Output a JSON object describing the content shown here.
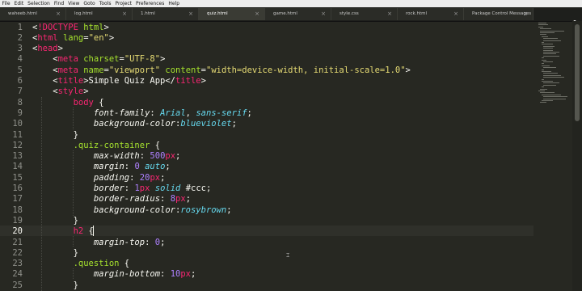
{
  "menu": [
    "File",
    "Edit",
    "Selection",
    "Find",
    "View",
    "Goto",
    "Tools",
    "Project",
    "Preferences",
    "Help"
  ],
  "tabs": [
    {
      "label": "waheeb.html",
      "active": false
    },
    {
      "label": "log.html",
      "active": false
    },
    {
      "label": "1.html",
      "active": false
    },
    {
      "label": "quiz.html",
      "active": true
    },
    {
      "label": "game.html",
      "active": false
    },
    {
      "label": "style.css",
      "active": false
    },
    {
      "label": "rock.html",
      "active": false
    },
    {
      "label": "Package Control Messages",
      "active": false
    }
  ],
  "tab_close_glyph": "×",
  "tab_scroll_glyph": "▾",
  "editor": {
    "active_line": 20,
    "lines": [
      {
        "n": 1,
        "tokens": [
          [
            "t-punc",
            "<"
          ],
          [
            "t-tag",
            "!DOCTYPE"
          ],
          [
            "t-punc",
            " "
          ],
          [
            "t-attr",
            "html"
          ],
          [
            "t-punc",
            ">"
          ]
        ]
      },
      {
        "n": 2,
        "tokens": [
          [
            "t-punc",
            "<"
          ],
          [
            "t-tag",
            "html"
          ],
          [
            "t-punc",
            " "
          ],
          [
            "t-attr",
            "lang"
          ],
          [
            "t-punc",
            "="
          ],
          [
            "t-str",
            "\"en\""
          ],
          [
            "t-punc",
            ">"
          ]
        ]
      },
      {
        "n": 3,
        "tokens": [
          [
            "t-punc",
            "<"
          ],
          [
            "t-tag",
            "head"
          ],
          [
            "t-punc",
            ">"
          ]
        ]
      },
      {
        "n": 4,
        "tokens": [
          [
            "t-punc",
            "    <"
          ],
          [
            "t-tag",
            "meta"
          ],
          [
            "t-punc",
            " "
          ],
          [
            "t-attr",
            "charset"
          ],
          [
            "t-punc",
            "="
          ],
          [
            "t-str",
            "\"UTF-8\""
          ],
          [
            "t-punc",
            ">"
          ]
        ]
      },
      {
        "n": 5,
        "tokens": [
          [
            "t-punc",
            "    <"
          ],
          [
            "t-tag",
            "meta"
          ],
          [
            "t-punc",
            " "
          ],
          [
            "t-attr",
            "name"
          ],
          [
            "t-punc",
            "="
          ],
          [
            "t-str",
            "\"viewport\""
          ],
          [
            "t-punc",
            " "
          ],
          [
            "t-attr",
            "content"
          ],
          [
            "t-punc",
            "="
          ],
          [
            "t-str",
            "\"width=device-width, initial-scale=1.0\""
          ],
          [
            "t-punc",
            ">"
          ]
        ]
      },
      {
        "n": 6,
        "tokens": [
          [
            "t-punc",
            "    <"
          ],
          [
            "t-tag",
            "title"
          ],
          [
            "t-punc",
            ">Simple Quiz App</"
          ],
          [
            "t-tag",
            "title"
          ],
          [
            "t-punc",
            ">"
          ]
        ]
      },
      {
        "n": 7,
        "tokens": [
          [
            "t-punc",
            "    <"
          ],
          [
            "t-tag",
            "style"
          ],
          [
            "t-punc",
            ">"
          ]
        ]
      },
      {
        "n": 8,
        "tokens": [
          [
            "t-punc",
            "        "
          ],
          [
            "t-tag",
            "body"
          ],
          [
            "t-punc",
            " {"
          ]
        ]
      },
      {
        "n": 9,
        "tokens": [
          [
            "t-punc",
            "            "
          ],
          [
            "t-prop",
            "font-family"
          ],
          [
            "t-punc",
            ": "
          ],
          [
            "t-val",
            "Arial"
          ],
          [
            "t-punc",
            ", "
          ],
          [
            "t-val",
            "sans-serif"
          ],
          [
            "t-punc",
            ";"
          ]
        ]
      },
      {
        "n": 10,
        "tokens": [
          [
            "t-punc",
            "            "
          ],
          [
            "t-prop",
            "background-color"
          ],
          [
            "t-punc",
            ":"
          ],
          [
            "t-val",
            "blueviolet"
          ],
          [
            "t-punc",
            ";"
          ]
        ]
      },
      {
        "n": 11,
        "tokens": [
          [
            "t-punc",
            "        }"
          ]
        ]
      },
      {
        "n": 12,
        "tokens": [
          [
            "t-punc",
            "        "
          ],
          [
            "t-sel",
            ".quiz-container"
          ],
          [
            "t-punc",
            " {"
          ]
        ]
      },
      {
        "n": 13,
        "tokens": [
          [
            "t-punc",
            "            "
          ],
          [
            "t-prop",
            "max-width"
          ],
          [
            "t-punc",
            ": "
          ],
          [
            "t-num",
            "500"
          ],
          [
            "t-unit",
            "px"
          ],
          [
            "t-punc",
            ";"
          ]
        ]
      },
      {
        "n": 14,
        "tokens": [
          [
            "t-punc",
            "            "
          ],
          [
            "t-prop",
            "margin"
          ],
          [
            "t-punc",
            ": "
          ],
          [
            "t-num",
            "0"
          ],
          [
            "t-punc",
            " "
          ],
          [
            "t-val",
            "auto"
          ],
          [
            "t-punc",
            ";"
          ]
        ]
      },
      {
        "n": 15,
        "tokens": [
          [
            "t-punc",
            "            "
          ],
          [
            "t-prop",
            "padding"
          ],
          [
            "t-punc",
            ": "
          ],
          [
            "t-num",
            "20"
          ],
          [
            "t-unit",
            "px"
          ],
          [
            "t-punc",
            ";"
          ]
        ]
      },
      {
        "n": 16,
        "tokens": [
          [
            "t-punc",
            "            "
          ],
          [
            "t-prop",
            "border"
          ],
          [
            "t-punc",
            ": "
          ],
          [
            "t-num",
            "1"
          ],
          [
            "t-unit",
            "px"
          ],
          [
            "t-punc",
            " "
          ],
          [
            "t-val",
            "solid"
          ],
          [
            "t-punc",
            " "
          ],
          [
            "t-hash",
            "#ccc"
          ],
          [
            "t-punc",
            ";"
          ]
        ]
      },
      {
        "n": 17,
        "tokens": [
          [
            "t-punc",
            "            "
          ],
          [
            "t-prop",
            "border-radius"
          ],
          [
            "t-punc",
            ": "
          ],
          [
            "t-num",
            "8"
          ],
          [
            "t-unit",
            "px"
          ],
          [
            "t-punc",
            ";"
          ]
        ]
      },
      {
        "n": 18,
        "tokens": [
          [
            "t-punc",
            "            "
          ],
          [
            "t-prop",
            "background-color"
          ],
          [
            "t-punc",
            ":"
          ],
          [
            "t-val",
            "rosybrown"
          ],
          [
            "t-punc",
            ";"
          ]
        ]
      },
      {
        "n": 19,
        "tokens": [
          [
            "t-punc",
            "        }"
          ]
        ]
      },
      {
        "n": 20,
        "tokens": [
          [
            "t-punc",
            "        "
          ],
          [
            "t-tag",
            "h2"
          ],
          [
            "t-punc",
            " {"
          ]
        ]
      },
      {
        "n": 21,
        "tokens": [
          [
            "t-punc",
            "            "
          ],
          [
            "t-prop",
            "margin-top"
          ],
          [
            "t-punc",
            ": "
          ],
          [
            "t-num",
            "0"
          ],
          [
            "t-punc",
            ";"
          ]
        ]
      },
      {
        "n": 22,
        "tokens": [
          [
            "t-punc",
            "        }"
          ]
        ]
      },
      {
        "n": 23,
        "tokens": [
          [
            "t-punc",
            "        "
          ],
          [
            "t-sel",
            ".question"
          ],
          [
            "t-punc",
            " {"
          ]
        ]
      },
      {
        "n": 24,
        "tokens": [
          [
            "t-punc",
            "            "
          ],
          [
            "t-prop",
            "margin-bottom"
          ],
          [
            "t-punc",
            ": "
          ],
          [
            "t-num",
            "10"
          ],
          [
            "t-unit",
            "px"
          ],
          [
            "t-punc",
            ";"
          ]
        ]
      },
      {
        "n": 25,
        "tokens": [
          [
            "t-punc",
            "        }"
          ]
        ]
      }
    ]
  },
  "colors": {
    "background": "#272822",
    "tag": "#f92672",
    "attribute": "#a6e22e",
    "string": "#e6db74",
    "number": "#ae81ff",
    "value": "#66d9ef"
  }
}
